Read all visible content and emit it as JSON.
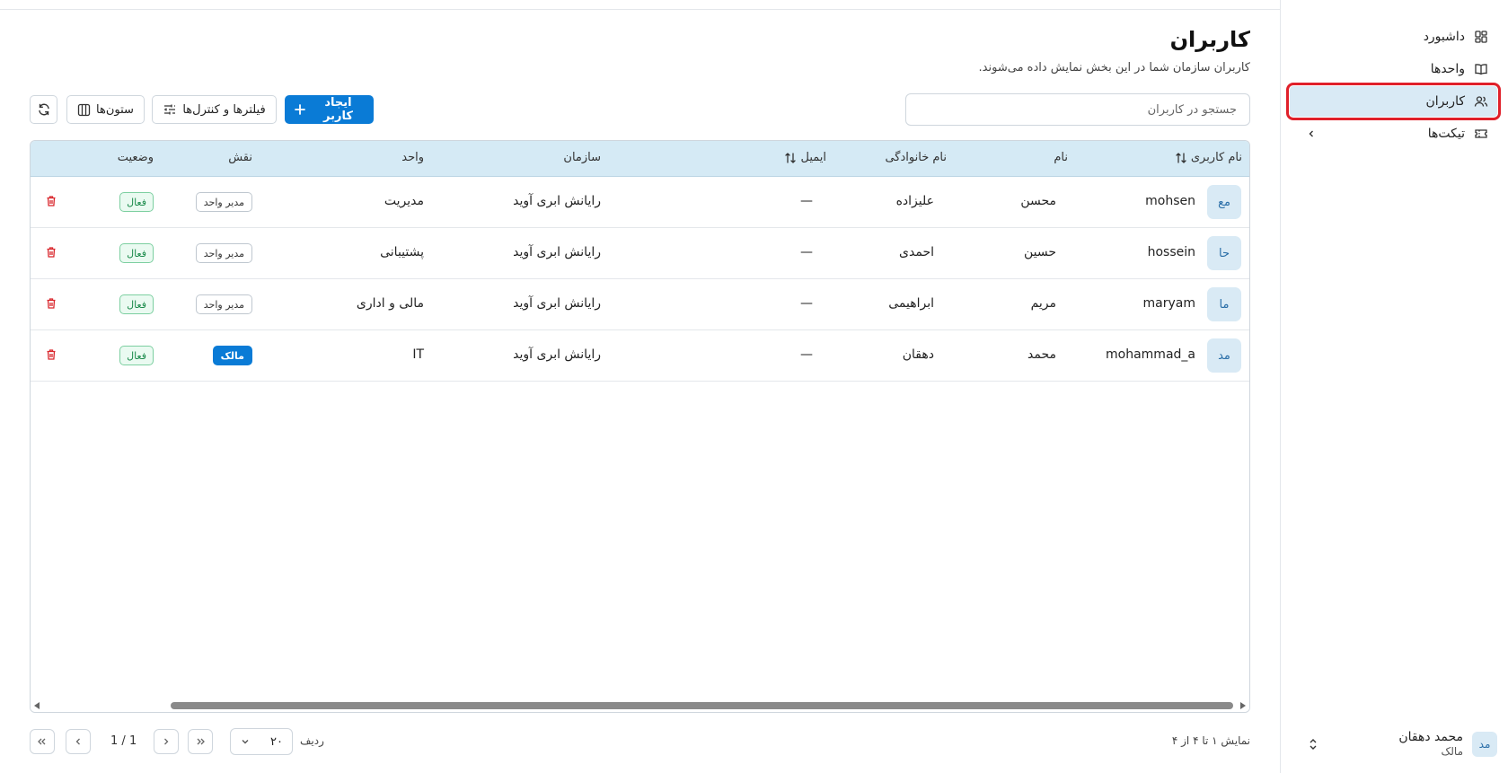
{
  "sidebar": {
    "items": [
      {
        "label": "داشبورد",
        "icon": "dashboard-icon"
      },
      {
        "label": "واحدها",
        "icon": "book-icon"
      },
      {
        "label": "کاربران",
        "icon": "users-icon",
        "active": true
      },
      {
        "label": "تیکت‌ها",
        "icon": "ticket-icon"
      }
    ],
    "user": {
      "initials": "مد",
      "name": "محمد دهقان",
      "role": "مالک"
    }
  },
  "page": {
    "title": "کاربران",
    "subtitle": "کاربران سازمان شما در این بخش نمایش داده می‌شوند."
  },
  "toolbar": {
    "search_placeholder": "جستجو در کاربران",
    "create_label": "ایجاد کاربر",
    "filters_label": "فیلترها و کنترل‌ها",
    "columns_label": "ستون‌ها"
  },
  "table": {
    "columns": {
      "username": "نام کاربری",
      "first_name": "نام",
      "last_name": "نام خانوادگی",
      "email": "ایمیل",
      "organization": "سازمان",
      "unit": "واحد",
      "role": "نقش",
      "status": "وضعیت"
    },
    "rows": [
      {
        "initials": "مع",
        "username": "mohsen",
        "first_name": "محسن",
        "last_name": "علیزاده",
        "email": "—",
        "organization": "رایانش ابری آوید",
        "unit": "مدیریت",
        "role": "مدیر واحد",
        "role_type": "manager",
        "status": "فعال"
      },
      {
        "initials": "حا",
        "username": "hossein",
        "first_name": "حسین",
        "last_name": "احمدی",
        "email": "—",
        "organization": "رایانش ابری آوید",
        "unit": "پشتیبانی",
        "role": "مدیر واحد",
        "role_type": "manager",
        "status": "فعال"
      },
      {
        "initials": "ما",
        "username": "maryam",
        "first_name": "مریم",
        "last_name": "ابراهیمی",
        "email": "—",
        "organization": "رایانش ابری آوید",
        "unit": "مالی و اداری",
        "role": "مدیر واحد",
        "role_type": "manager",
        "status": "فعال"
      },
      {
        "initials": "مد",
        "username": "mohammad_a",
        "first_name": "محمد",
        "last_name": "دهقان",
        "email": "—",
        "organization": "رایانش ابری آوید",
        "unit": "IT",
        "role": "مالک",
        "role_type": "owner",
        "status": "فعال"
      }
    ]
  },
  "footer": {
    "showing": "نمایش ۱ تا ۴ از ۴",
    "rows_label": "ردیف",
    "rows_per_page": "۲۰",
    "page_indicator": "1 / 1"
  },
  "colors": {
    "primary": "#0a7bd6",
    "header_bg": "#d5eaf5",
    "active_nav": "#d9eaf5",
    "highlight_border": "#e0202a",
    "status_green": "#1a8a4a",
    "delete_red": "#d9262c"
  }
}
